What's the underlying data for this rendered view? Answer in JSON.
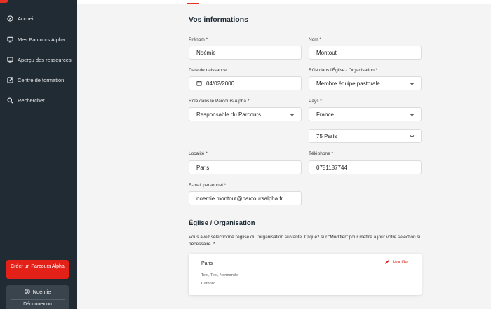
{
  "sidebar": {
    "items": [
      {
        "label": "Accueil",
        "icon": "compass-icon"
      },
      {
        "label": "Mes Parcours Alpha",
        "icon": "monitor-icon"
      },
      {
        "label": "Aperçu des ressources",
        "icon": "screen-icon"
      },
      {
        "label": "Centre de formation",
        "icon": "external-doc-icon"
      },
      {
        "label": "Rechercher",
        "icon": "search-icon"
      }
    ],
    "create_button": "Créer un Parcours Alpha",
    "user_name": "Noémie",
    "logout": "Déconnexion"
  },
  "info": {
    "title": "Vos informations",
    "prenom_label": "Prénom *",
    "prenom_value": "Noémie",
    "nom_label": "Nom *",
    "nom_value": "Montout",
    "dob_label": "Date de naissance",
    "dob_value": "04/02/2000",
    "role_eglise_label": "Rôle dans l'Église / Organisation *",
    "role_eglise_value": "Membre équipe pastorale",
    "role_parcours_label": "Rôle dans le Parcours Alpha *",
    "role_parcours_value": "Responsable du Parcours",
    "pays_label": "Pays *",
    "pays_value": "France",
    "region_value": "75 Paris",
    "localite_label": "Localité *",
    "localite_value": "Paris",
    "telephone_label": "Téléphone *",
    "telephone_value": "0781187744",
    "email_label": "E-mail personnel *",
    "email_value": "noemie.montout@parcoursalpha.fr"
  },
  "church": {
    "title": "Église / Organisation",
    "description": "Vous avez sélectionné l'église ou l'organisation suivante. Cliquez sur \"Modifier\" pour mettre à jour votre sélection si nécessaire. *",
    "card_name": "Paris",
    "card_address": "Test, Test, Normandie",
    "card_type": "Catholic",
    "edit_label": "Modifier"
  },
  "colors": {
    "sidebar_bg": "#212b33",
    "accent": "#e32119",
    "page_bg": "#f4f4f5"
  }
}
